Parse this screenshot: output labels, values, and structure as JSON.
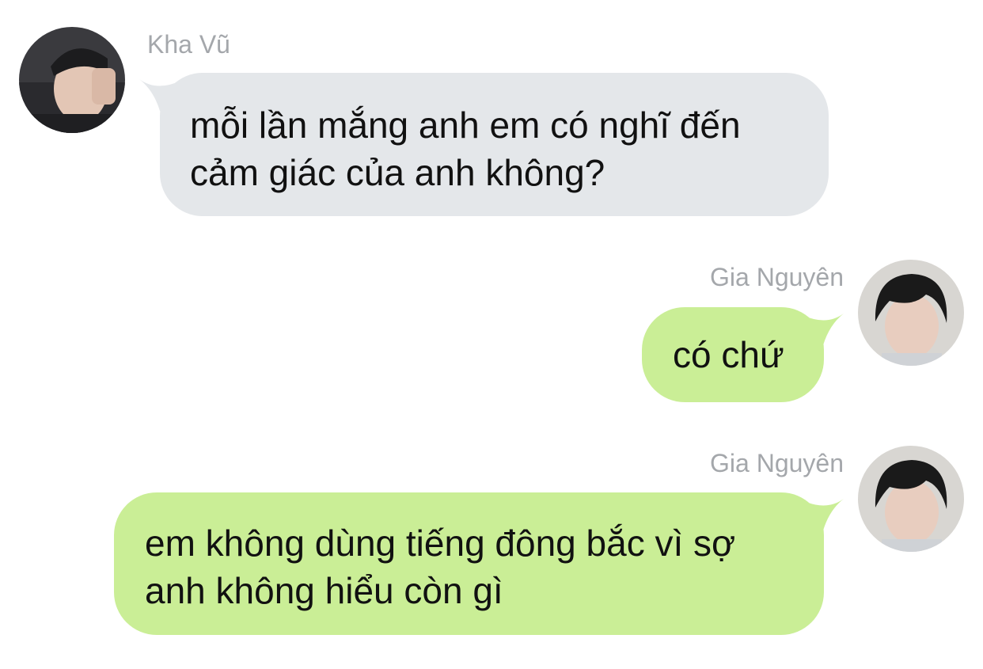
{
  "conversation": {
    "messages": [
      {
        "sender": "Kha Vũ",
        "direction": "incoming",
        "avatar": "avatar-kha-vu",
        "lines": [
          "mỗi lần mắng anh em có nghĩ đến",
          "cảm giác của anh không?"
        ]
      },
      {
        "sender": "Gia Nguyên",
        "direction": "outgoing",
        "avatar": "avatar-gia-nguyen",
        "lines": [
          "có chứ"
        ]
      },
      {
        "sender": "Gia Nguyên",
        "direction": "outgoing",
        "avatar": "avatar-gia-nguyen",
        "lines": [
          "em không dùng tiếng đông bắc vì sợ",
          "anh không hiểu còn gì"
        ]
      }
    ]
  },
  "colors": {
    "incoming_bubble": "#e4e7ea",
    "outgoing_bubble": "#caee96",
    "sender_name": "#a4a7ab",
    "message_text": "#111111"
  }
}
